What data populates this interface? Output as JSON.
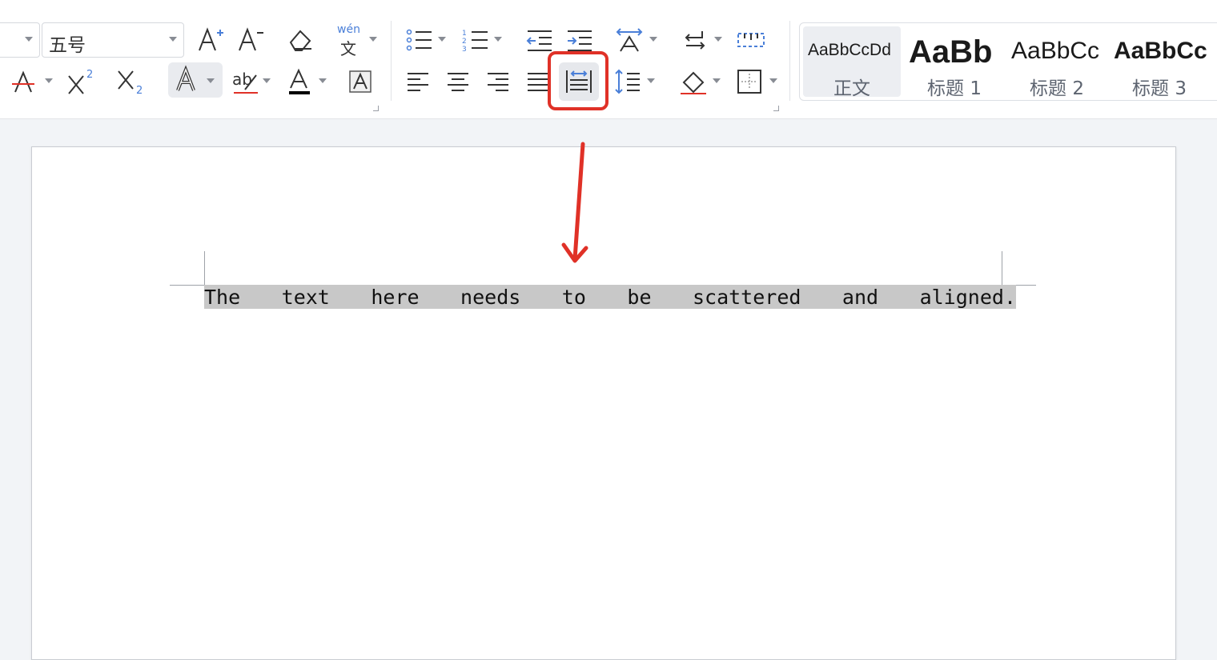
{
  "ribbon": {
    "font_size_value": "五号",
    "pinyin_label": "wén",
    "styles": [
      {
        "sample": "AaBbCcDd",
        "name": "正文",
        "active": true
      },
      {
        "sample": "AaBb",
        "name": "标题 1"
      },
      {
        "sample": "AaBbCc",
        "name": "标题 2"
      },
      {
        "sample": "AaBbCc",
        "name": "标题 3"
      }
    ],
    "colors": {
      "accent": "#4a7fd8",
      "highlight_border": "#e03127",
      "font_color_bar": "#000000",
      "strike_red": "#e03127"
    }
  },
  "document": {
    "text": "The text here needs to be scattered and aligned."
  }
}
